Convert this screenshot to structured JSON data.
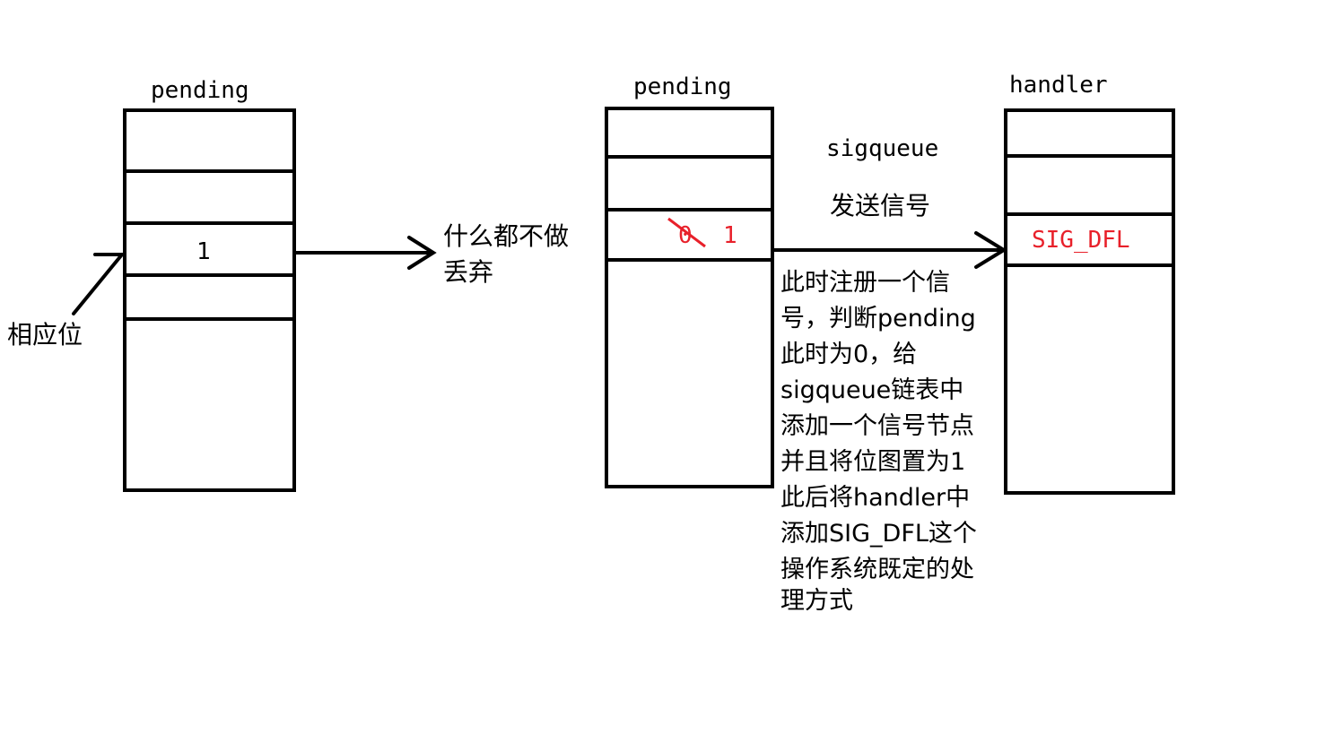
{
  "left": {
    "title": "pending",
    "bit_value": "1",
    "pointer_label": "相应位",
    "result_line1": "什么都不做",
    "result_line2": "丢弃"
  },
  "middle": {
    "title": "pending",
    "old_value": "0",
    "new_value": "1",
    "action_top": "sigqueue",
    "action_bottom": "发送信号"
  },
  "right": {
    "title": "handler",
    "entry": "SIG_DFL"
  },
  "explanation": [
    "此时注册一个信",
    "号，判断pending",
    "此时为0，给",
    "sigqueue链表中",
    "添加一个信号节点",
    "并且将位图置为1",
    "此后将handler中",
    "添加SIG_DFL这个",
    "操作系统既定的处",
    "理方式"
  ],
  "colors": {
    "ink": "#000000",
    "highlight": "#e8202a"
  }
}
